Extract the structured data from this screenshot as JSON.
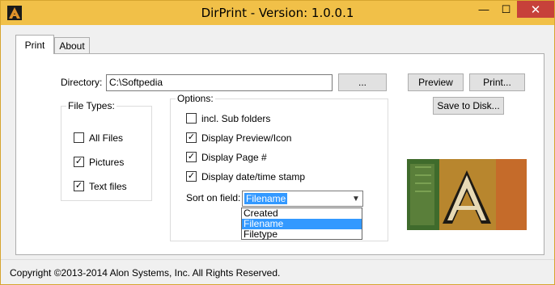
{
  "window": {
    "title": "DirPrint - Version: 1.0.0.1",
    "min_glyph": "—",
    "max_glyph": "☐",
    "close_glyph": "✕",
    "app_icon": "app-logo-icon"
  },
  "tabs": [
    {
      "label": "Print",
      "active": true
    },
    {
      "label": "About",
      "active": false
    }
  ],
  "directory": {
    "label": "Directory:",
    "value": "C:\\Softpedia",
    "browse_label": "..."
  },
  "buttons": {
    "preview": "Preview",
    "print": "Print...",
    "save": "Save to Disk..."
  },
  "file_types": {
    "legend": "File Types:",
    "items": [
      {
        "label": "All Files",
        "checked": false
      },
      {
        "label": "Pictures",
        "checked": true
      },
      {
        "label": "Text files",
        "checked": true
      }
    ]
  },
  "options": {
    "legend": "Options:",
    "items": [
      {
        "label": "incl. Sub folders",
        "checked": false
      },
      {
        "label": "Display Preview/Icon",
        "checked": true
      },
      {
        "label": "Display Page #",
        "checked": true
      },
      {
        "label": "Display date/time stamp",
        "checked": true
      }
    ],
    "sort_label": "Sort on field:",
    "sort_value": "Filename",
    "sort_options": [
      {
        "label": "Created",
        "selected": false
      },
      {
        "label": "Filename",
        "selected": true
      },
      {
        "label": "Filetype",
        "selected": false
      }
    ]
  },
  "status": {
    "text": "Copyright ©2013-2014 Alon Systems, Inc. All Rights Reserved."
  },
  "colors": {
    "titlebar": "#f1c048",
    "close": "#c7413a",
    "selection": "#3399ff"
  }
}
